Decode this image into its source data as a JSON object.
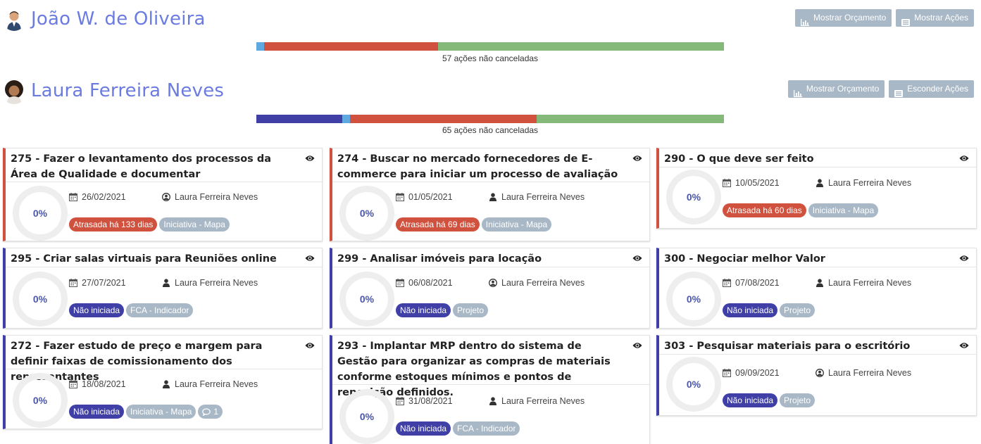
{
  "colors": {
    "name_color": "#6b7be0",
    "button_bg": "#a9b8c6",
    "late": "#d0523e",
    "not_started": "#3f3fa6",
    "blue_light": "#5fa8e0",
    "green": "#85b97a",
    "tag": "#a9b8c6"
  },
  "people": [
    {
      "name": "João W. de Oliveira",
      "btn_budget": "Mostrar Orçamento",
      "btn_actions": "Mostrar Ações",
      "summary": "57 ações não canceladas",
      "progress": [
        {
          "color": "#5fa8e0",
          "fraction": 0.017
        },
        {
          "color": "#d0523e",
          "fraction": 0.372
        },
        {
          "color": "#85b97a",
          "fraction": 0.611
        }
      ]
    },
    {
      "name": "Laura Ferreira Neves",
      "btn_budget": "Mostrar Orçamento",
      "btn_actions": "Esconder Ações",
      "summary": "65 ações não canceladas",
      "progress": [
        {
          "color": "#3f3fa6",
          "fraction": 0.184
        },
        {
          "color": "#5fa8e0",
          "fraction": 0.016
        },
        {
          "color": "#d0523e",
          "fraction": 0.4
        },
        {
          "color": "#85b97a",
          "fraction": 0.4
        }
      ]
    }
  ],
  "cards": [
    {
      "title": "275 - Fazer o levantamento dos processos da Área de Qualidade e documentar",
      "percent": "0%",
      "date": "26/02/2021",
      "person": "Laura Ferreira Neves",
      "status": "Atrasada há 133 dias",
      "tag": "Iniciativa - Mapa",
      "late": true,
      "user_icon": "user-circle-icon"
    },
    {
      "title": "274 - Buscar no mercado fornecedores de E-commerce para iniciar um processo de avaliação",
      "percent": "0%",
      "date": "01/05/2021",
      "person": "Laura Ferreira Neves",
      "status": "Atrasada há 69 dias",
      "tag": "Iniciativa - Mapa",
      "late": true,
      "user_icon": "user-icon"
    },
    {
      "title": "290 - O que deve ser feito",
      "percent": "0%",
      "date": "10/05/2021",
      "person": "Laura Ferreira Neves",
      "status": "Atrasada há 60 dias",
      "tag": "Iniciativa - Mapa",
      "late": true,
      "user_icon": "user-icon"
    },
    {
      "title": "295 - Criar salas virtuais para Reuniões online",
      "percent": "0%",
      "date": "27/07/2021",
      "person": "Laura Ferreira Neves",
      "status": "Não iniciada",
      "tag": "FCA - Indicador",
      "late": false,
      "user_icon": "user-icon"
    },
    {
      "title": "299 - Analisar imóveis para locação",
      "percent": "0%",
      "date": "06/08/2021",
      "person": "Laura Ferreira Neves",
      "status": "Não iniciada",
      "tag": "Projeto",
      "late": false,
      "user_icon": "user-circle-icon"
    },
    {
      "title": "300 - Negociar melhor Valor",
      "percent": "0%",
      "date": "07/08/2021",
      "person": "Laura Ferreira Neves",
      "status": "Não iniciada",
      "tag": "Projeto",
      "late": false,
      "user_icon": "user-icon"
    },
    {
      "title": "272 - Fazer estudo de preço e margem para definir faixas de comissionamento dos representantes",
      "percent": "0%",
      "date": "18/08/2021",
      "person": "Laura Ferreira Neves",
      "status": "Não iniciada",
      "tag": "Iniciativa - Mapa",
      "comments": "1",
      "late": false,
      "user_icon": "user-icon"
    },
    {
      "title": "293 - Implantar MRP dentro do sistema de Gestão para organizar as compras de materiais conforme estoques mínimos e pontos de reposição definidos.",
      "percent": "0%",
      "date": "31/08/2021",
      "person": "Laura Ferreira Neves",
      "status": "Não iniciada",
      "tag": "FCA - Indicador",
      "late": false,
      "user_icon": "user-icon"
    },
    {
      "title": "303 - Pesquisar materiais para o escritório",
      "percent": "0%",
      "date": "09/09/2021",
      "person": "Laura Ferreira Neves",
      "status": "Não iniciada",
      "tag": "Projeto",
      "late": false,
      "user_icon": "user-circle-icon"
    }
  ]
}
